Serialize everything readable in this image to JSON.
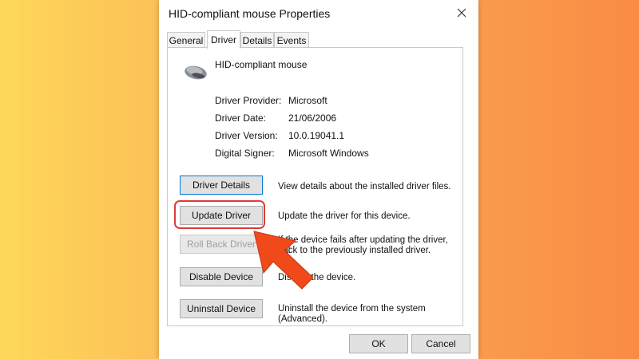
{
  "window": {
    "title": "HID-compliant mouse Properties"
  },
  "tabs": [
    {
      "label": "General"
    },
    {
      "label": "Driver"
    },
    {
      "label": "Details"
    },
    {
      "label": "Events"
    }
  ],
  "device": {
    "name": "HID-compliant mouse",
    "icon": "mouse-icon"
  },
  "info": [
    {
      "label": "Driver Provider:",
      "value": "Microsoft"
    },
    {
      "label": "Driver Date:",
      "value": "21/06/2006"
    },
    {
      "label": "Driver Version:",
      "value": "10.0.19041.1"
    },
    {
      "label": "Digital Signer:",
      "value": "Microsoft Windows"
    }
  ],
  "actions": [
    {
      "button": "Driver Details",
      "desc_line1": "View details about the installed driver files.",
      "desc_line2": ""
    },
    {
      "button": "Update Driver",
      "desc_line1": "Update the driver for this device.",
      "desc_line2": ""
    },
    {
      "button": "Roll Back Driver",
      "desc_line1": "If the device fails after updating the driver, roll",
      "desc_line2": "back to the previously installed driver."
    },
    {
      "button": "Disable Device",
      "desc_line1": "Disable the device.",
      "desc_line2": ""
    },
    {
      "button": "Uninstall Device",
      "desc_line1": "Uninstall the device from the system (Advanced).",
      "desc_line2": ""
    }
  ],
  "footer": {
    "ok_label": "OK",
    "cancel_label": "Cancel"
  },
  "colors": {
    "highlight": "#e03a3a",
    "arrow": "#f04a1a",
    "focus": "#0078d7"
  }
}
